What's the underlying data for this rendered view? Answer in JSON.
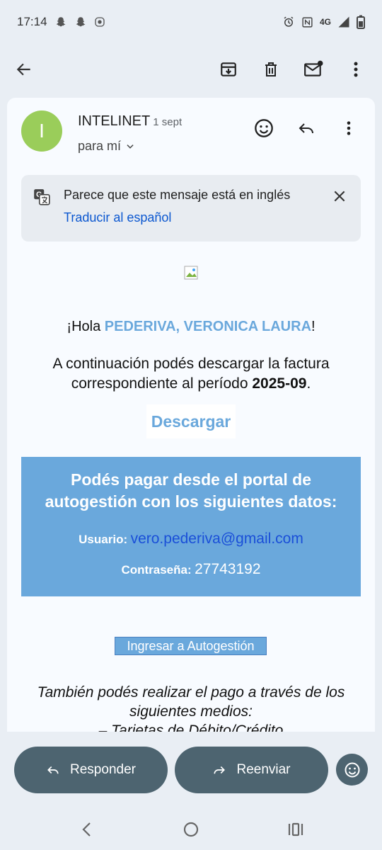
{
  "status_bar": {
    "time": "17:14",
    "network": "4G",
    "icons_left": [
      "snapchat-icon",
      "snapchat-icon",
      "record-icon"
    ],
    "icons_right": [
      "alarm-icon",
      "nfc-icon",
      "signal-icon",
      "battery-icon"
    ]
  },
  "toolbar": {
    "back_icon": "arrow-back-icon",
    "actions": [
      "archive-icon",
      "delete-icon",
      "mark-unread-icon",
      "more-vert-icon"
    ]
  },
  "email": {
    "avatar_letter": "I",
    "avatar_color": "#9acd5a",
    "sender": "INTELINET",
    "date": "1 sept",
    "recipient": "para mí",
    "actions": [
      "emoji-icon",
      "reply-icon",
      "more-vert-icon"
    ]
  },
  "translate": {
    "message": "Parece que este mensaje está en inglés",
    "link": "Traducir al español"
  },
  "body": {
    "greeting_prefix": "¡Hola ",
    "customer_name": "PEDERIVA, VERONICA LAURA",
    "greeting_suffix": "!",
    "intro_line1": "A continuación podés descargar la factura",
    "intro_line2": "correspondiente al período ",
    "period": "2025-09",
    "intro_end": ".",
    "download_label": "Descargar",
    "portal_title_line1": "Podés pagar desde el portal de",
    "portal_title_line2": "autogestión con los siguientes datos:",
    "user_label": "Usuario:",
    "user_value": "vero.pederiva@gmail.com",
    "password_label": "Contraseña:",
    "password_value": "27743192",
    "autogestion_label": "Ingresar a Autogestión",
    "also_line1": "También podés realizar el pago a través de los",
    "also_line2": "siguientes medios:",
    "also_line3": "– Tarjetas de Débito/Crédito"
  },
  "bottom": {
    "reply_label": "Responder",
    "forward_label": "Reenviar"
  },
  "colors": {
    "accent_blue": "#6aa8dc",
    "link_blue": "#0b57d0",
    "pill": "#4d6470"
  }
}
